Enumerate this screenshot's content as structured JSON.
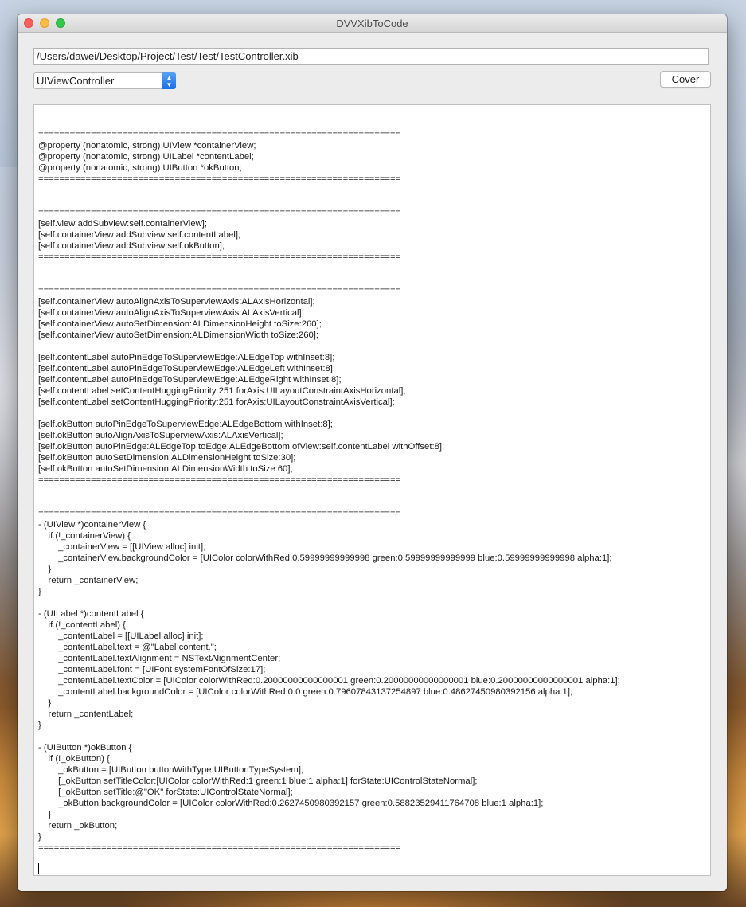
{
  "window": {
    "title": "DVVXibToCode",
    "controls": [
      "close",
      "minimize",
      "zoom"
    ]
  },
  "path_field": {
    "value": "/Users/dawei/Desktop/Project/Test/Test/TestController.xib"
  },
  "type_popup": {
    "selected": "UIViewController",
    "icon": "chevron-updown-icon"
  },
  "cover_button": {
    "label": "Cover"
  },
  "output": {
    "text": "=====================================================================\n@property (nonatomic, strong) UIView *containerView;\n@property (nonatomic, strong) UILabel *contentLabel;\n@property (nonatomic, strong) UIButton *okButton;\n=====================================================================\n\n\n=====================================================================\n[self.view addSubview:self.containerView];\n[self.containerView addSubview:self.contentLabel];\n[self.containerView addSubview:self.okButton];\n=====================================================================\n\n\n=====================================================================\n[self.containerView autoAlignAxisToSuperviewAxis:ALAxisHorizontal];\n[self.containerView autoAlignAxisToSuperviewAxis:ALAxisVertical];\n[self.containerView autoSetDimension:ALDimensionHeight toSize:260];\n[self.containerView autoSetDimension:ALDimensionWidth toSize:260];\n\n[self.contentLabel autoPinEdgeToSuperviewEdge:ALEdgeTop withInset:8];\n[self.contentLabel autoPinEdgeToSuperviewEdge:ALEdgeLeft withInset:8];\n[self.contentLabel autoPinEdgeToSuperviewEdge:ALEdgeRight withInset:8];\n[self.contentLabel setContentHuggingPriority:251 forAxis:UILayoutConstraintAxisHorizontal];\n[self.contentLabel setContentHuggingPriority:251 forAxis:UILayoutConstraintAxisVertical];\n\n[self.okButton autoPinEdgeToSuperviewEdge:ALEdgeBottom withInset:8];\n[self.okButton autoAlignAxisToSuperviewAxis:ALAxisVertical];\n[self.okButton autoPinEdge:ALEdgeTop toEdge:ALEdgeBottom ofView:self.contentLabel withOffset:8];\n[self.okButton autoSetDimension:ALDimensionHeight toSize:30];\n[self.okButton autoSetDimension:ALDimensionWidth toSize:60];\n=====================================================================\n\n\n=====================================================================\n- (UIView *)containerView {\n    if (!_containerView) {\n        _containerView = [[UIView alloc] init];\n        _containerView.backgroundColor = [UIColor colorWithRed:0.59999999999998 green:0.59999999999999 blue:0.59999999999998 alpha:1];\n    }\n    return _containerView;\n}\n\n- (UILabel *)contentLabel {\n    if (!_contentLabel) {\n        _contentLabel = [[UILabel alloc] init];\n        _contentLabel.text = @\"Label content.\";\n        _contentLabel.textAlignment = NSTextAlignmentCenter;\n        _contentLabel.font = [UIFont systemFontOfSize:17];\n        _contentLabel.textColor = [UIColor colorWithRed:0.20000000000000001 green:0.20000000000000001 blue:0.20000000000000001 alpha:1];\n        _contentLabel.backgroundColor = [UIColor colorWithRed:0.0 green:0.79607843137254897 blue:0.48627450980392156 alpha:1];\n    }\n    return _contentLabel;\n}\n\n- (UIButton *)okButton {\n    if (!_okButton) {\n        _okButton = [UIButton buttonWithType:UIButtonTypeSystem];\n        [_okButton setTitleColor:[UIColor colorWithRed:1 green:1 blue:1 alpha:1] forState:UIControlStateNormal];\n        [_okButton setTitle:@\"OK\" forState:UIControlStateNormal];\n        _okButton.backgroundColor = [UIColor colorWithRed:0.2627450980392157 green:0.58823529411764708 blue:1 alpha:1];\n    }\n    return _okButton;\n}\n====================================================================="
  }
}
